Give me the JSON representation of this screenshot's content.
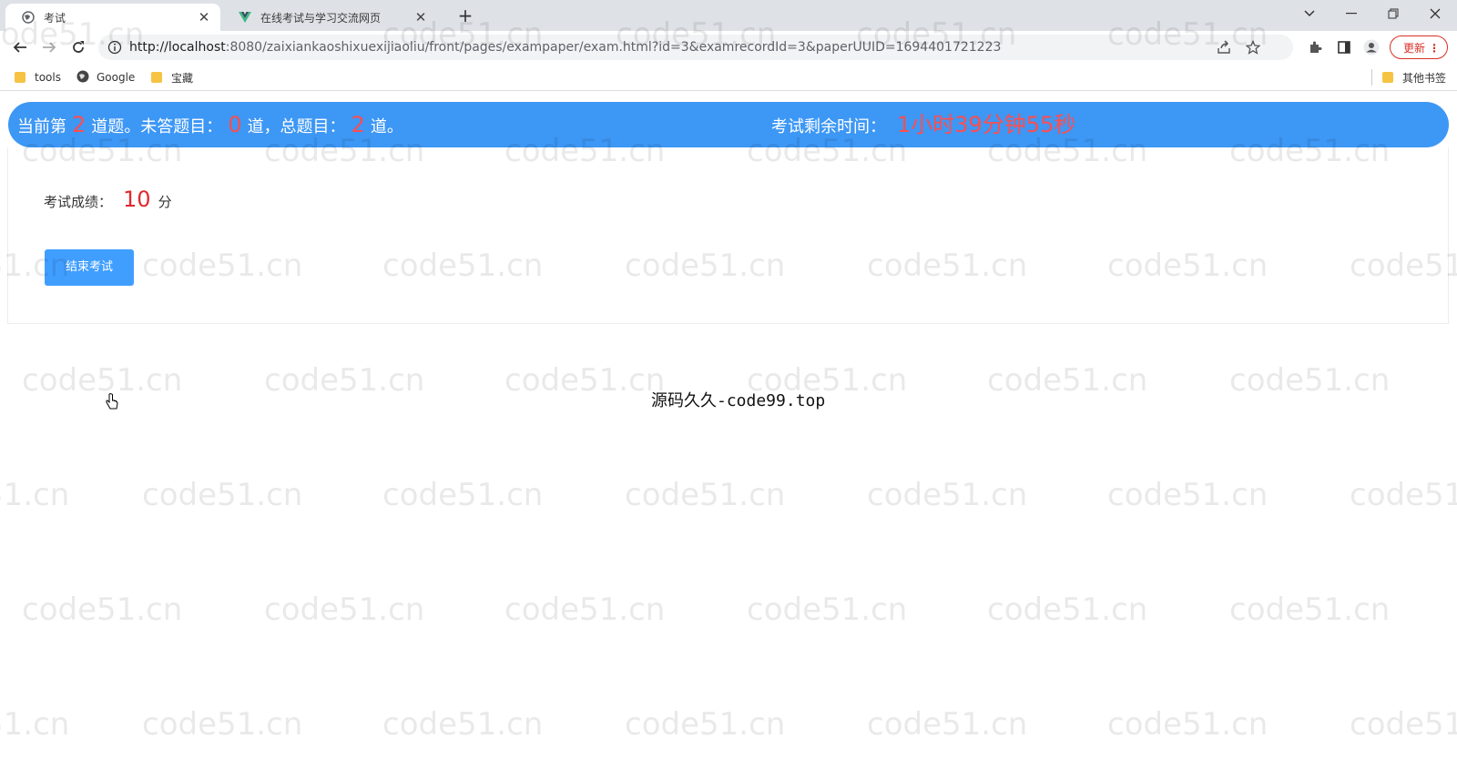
{
  "browser": {
    "tabs": [
      {
        "title": "考试",
        "active": true
      },
      {
        "title": "在线考试与学习交流网页",
        "active": false
      }
    ],
    "url_host": "http://localhost",
    "url_rest": ":8080/zaixiankaoshixuexijiaoliu/front/pages/exampaper/exam.html?id=3&examrecordId=3&paperUUID=1694401721223",
    "update_label": "更新",
    "bookmarks": [
      {
        "label": "tools",
        "icon": "folder-icon"
      },
      {
        "label": "Google",
        "icon": "globe-icon"
      },
      {
        "label": "宝藏",
        "icon": "folder-icon"
      }
    ],
    "other_bookmarks": "其他书签"
  },
  "exam": {
    "current_prefix": "当前第",
    "current_index": "2",
    "current_suffix": "道题。未答题目：",
    "unanswered": "0",
    "unanswered_suffix": "道，总题目：",
    "total": "2",
    "total_suffix": "道。",
    "time_label": "考试剩余时间：",
    "time_remaining": "1小时39分钟55秒",
    "score_label": "考试成绩：",
    "score_value": "10",
    "score_unit": "分",
    "end_button": "结束考试"
  },
  "footer_text": "源码久久-code99.top",
  "watermark_text": "code51.cn",
  "colors": {
    "exam_bar": "#3d97f5",
    "highlight_red": "#ff4d4f",
    "score_red": "#e0282e",
    "button_blue": "#409eff"
  }
}
